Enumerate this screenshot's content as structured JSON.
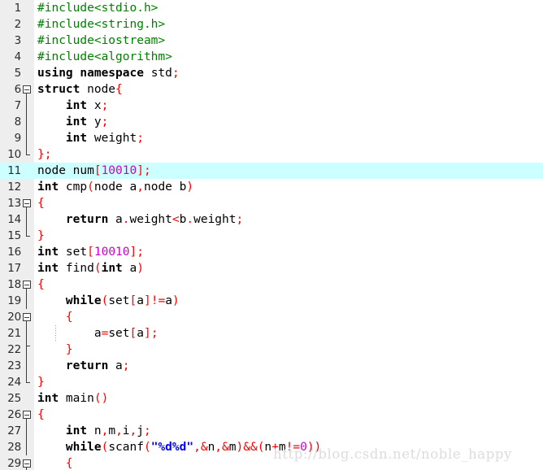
{
  "editor": {
    "language": "C++",
    "first_visible_line": 1,
    "last_visible_line": 29,
    "highlighted_line": 11,
    "gutter_background": "#eeeeee",
    "editor_background": "#ffffff",
    "current_line_highlight": "#ccffff",
    "colors": {
      "keyword": "#000000",
      "preprocessor": "#008000",
      "punctuation": "#ff0000",
      "number": "#cc00cc",
      "string": "#0000ff",
      "plain": "#000000",
      "line_number": "#2b2b2b",
      "fold_marker": "#3c3c3c",
      "indent_guide": "#9a9a9a",
      "watermark": "#dcdcdc"
    }
  },
  "watermark": {
    "text": "http://blog.csdn.net/noble_happy"
  },
  "lines": [
    {
      "n": "1",
      "fold": "none",
      "indent_guides": [],
      "tokens": [
        {
          "t": "#include<stdio.h>",
          "c": "pp"
        }
      ]
    },
    {
      "n": "2",
      "fold": "none",
      "indent_guides": [],
      "tokens": [
        {
          "t": "#include<string.h>",
          "c": "pp"
        }
      ]
    },
    {
      "n": "3",
      "fold": "none",
      "indent_guides": [],
      "tokens": [
        {
          "t": "#include<iostream>",
          "c": "pp"
        }
      ]
    },
    {
      "n": "4",
      "fold": "none",
      "indent_guides": [],
      "tokens": [
        {
          "t": "#include<algorithm>",
          "c": "pp"
        }
      ]
    },
    {
      "n": "5",
      "fold": "none",
      "indent_guides": [],
      "tokens": [
        {
          "t": "using namespace",
          "c": "kw"
        },
        {
          "t": " ",
          "c": "pln"
        },
        {
          "t": "std",
          "c": "pln"
        },
        {
          "t": ";",
          "c": "punc"
        }
      ]
    },
    {
      "n": "6",
      "fold": "box",
      "indent_guides": [],
      "tokens": [
        {
          "t": "struct",
          "c": "kw"
        },
        {
          "t": " node",
          "c": "pln"
        },
        {
          "t": "{",
          "c": "punc"
        }
      ]
    },
    {
      "n": "7",
      "fold": "line",
      "indent_guides": [],
      "tokens": [
        {
          "t": "    ",
          "c": "pln"
        },
        {
          "t": "int",
          "c": "kw"
        },
        {
          "t": " x",
          "c": "pln"
        },
        {
          "t": ";",
          "c": "punc"
        }
      ]
    },
    {
      "n": "8",
      "fold": "line",
      "indent_guides": [],
      "tokens": [
        {
          "t": "    ",
          "c": "pln"
        },
        {
          "t": "int",
          "c": "kw"
        },
        {
          "t": " y",
          "c": "pln"
        },
        {
          "t": ";",
          "c": "punc"
        }
      ]
    },
    {
      "n": "9",
      "fold": "line",
      "indent_guides": [],
      "tokens": [
        {
          "t": "    ",
          "c": "pln"
        },
        {
          "t": "int",
          "c": "kw"
        },
        {
          "t": " weight",
          "c": "pln"
        },
        {
          "t": ";",
          "c": "punc"
        }
      ]
    },
    {
      "n": "10",
      "fold": "end",
      "indent_guides": [],
      "tokens": [
        {
          "t": "};",
          "c": "punc"
        }
      ]
    },
    {
      "n": "11",
      "fold": "none",
      "highlight": true,
      "indent_guides": [],
      "tokens": [
        {
          "t": "node num",
          "c": "pln"
        },
        {
          "t": "[",
          "c": "punc"
        },
        {
          "t": "10010",
          "c": "num"
        },
        {
          "t": "];",
          "c": "punc"
        }
      ]
    },
    {
      "n": "12",
      "fold": "none",
      "indent_guides": [],
      "tokens": [
        {
          "t": "int",
          "c": "kw"
        },
        {
          "t": " cmp",
          "c": "pln"
        },
        {
          "t": "(",
          "c": "punc"
        },
        {
          "t": "node a",
          "c": "pln"
        },
        {
          "t": ",",
          "c": "punc"
        },
        {
          "t": "node b",
          "c": "pln"
        },
        {
          "t": ")",
          "c": "punc"
        }
      ]
    },
    {
      "n": "13",
      "fold": "box",
      "indent_guides": [],
      "tokens": [
        {
          "t": "{",
          "c": "punc"
        }
      ]
    },
    {
      "n": "14",
      "fold": "line",
      "indent_guides": [],
      "tokens": [
        {
          "t": "    ",
          "c": "pln"
        },
        {
          "t": "return",
          "c": "kw"
        },
        {
          "t": " a",
          "c": "pln"
        },
        {
          "t": ".",
          "c": "punc"
        },
        {
          "t": "weight",
          "c": "pln"
        },
        {
          "t": "<",
          "c": "punc"
        },
        {
          "t": "b",
          "c": "pln"
        },
        {
          "t": ".",
          "c": "punc"
        },
        {
          "t": "weight",
          "c": "pln"
        },
        {
          "t": ";",
          "c": "punc"
        }
      ]
    },
    {
      "n": "15",
      "fold": "end",
      "indent_guides": [],
      "tokens": [
        {
          "t": "}",
          "c": "punc"
        }
      ]
    },
    {
      "n": "16",
      "fold": "none",
      "indent_guides": [],
      "tokens": [
        {
          "t": "int",
          "c": "kw"
        },
        {
          "t": " set",
          "c": "pln"
        },
        {
          "t": "[",
          "c": "punc"
        },
        {
          "t": "10010",
          "c": "num"
        },
        {
          "t": "];",
          "c": "punc"
        }
      ]
    },
    {
      "n": "17",
      "fold": "none",
      "indent_guides": [],
      "tokens": [
        {
          "t": "int",
          "c": "kw"
        },
        {
          "t": " find",
          "c": "pln"
        },
        {
          "t": "(",
          "c": "punc"
        },
        {
          "t": "int",
          "c": "kw"
        },
        {
          "t": " a",
          "c": "pln"
        },
        {
          "t": ")",
          "c": "punc"
        }
      ]
    },
    {
      "n": "18",
      "fold": "box",
      "indent_guides": [],
      "tokens": [
        {
          "t": "{",
          "c": "punc"
        }
      ]
    },
    {
      "n": "19",
      "fold": "line",
      "indent_guides": [],
      "tokens": [
        {
          "t": "    ",
          "c": "pln"
        },
        {
          "t": "while",
          "c": "kw"
        },
        {
          "t": "(",
          "c": "punc"
        },
        {
          "t": "set",
          "c": "pln"
        },
        {
          "t": "[",
          "c": "punc"
        },
        {
          "t": "a",
          "c": "pln"
        },
        {
          "t": "]!=",
          "c": "punc"
        },
        {
          "t": "a",
          "c": "pln"
        },
        {
          "t": ")",
          "c": "punc"
        }
      ]
    },
    {
      "n": "20",
      "fold": "box-in-line",
      "indent_guides": [],
      "tokens": [
        {
          "t": "    ",
          "c": "pln"
        },
        {
          "t": "{",
          "c": "punc"
        }
      ]
    },
    {
      "n": "21",
      "fold": "line",
      "indent_guides": [
        68
      ],
      "tokens": [
        {
          "t": "        ",
          "c": "pln"
        },
        {
          "t": "a",
          "c": "pln"
        },
        {
          "t": "=",
          "c": "punc"
        },
        {
          "t": "set",
          "c": "pln"
        },
        {
          "t": "[",
          "c": "punc"
        },
        {
          "t": "a",
          "c": "pln"
        },
        {
          "t": "];",
          "c": "punc"
        }
      ]
    },
    {
      "n": "22",
      "fold": "tick",
      "indent_guides": [],
      "tokens": [
        {
          "t": "    ",
          "c": "pln"
        },
        {
          "t": "}",
          "c": "punc"
        }
      ]
    },
    {
      "n": "23",
      "fold": "line",
      "indent_guides": [],
      "tokens": [
        {
          "t": "    ",
          "c": "pln"
        },
        {
          "t": "return",
          "c": "kw"
        },
        {
          "t": " a",
          "c": "pln"
        },
        {
          "t": ";",
          "c": "punc"
        }
      ]
    },
    {
      "n": "24",
      "fold": "end",
      "indent_guides": [],
      "tokens": [
        {
          "t": "}",
          "c": "punc"
        }
      ]
    },
    {
      "n": "25",
      "fold": "none",
      "indent_guides": [],
      "tokens": [
        {
          "t": "int",
          "c": "kw"
        },
        {
          "t": " main",
          "c": "pln"
        },
        {
          "t": "()",
          "c": "punc"
        }
      ]
    },
    {
      "n": "26",
      "fold": "box",
      "indent_guides": [],
      "tokens": [
        {
          "t": "{",
          "c": "punc"
        }
      ]
    },
    {
      "n": "27",
      "fold": "line",
      "indent_guides": [],
      "tokens": [
        {
          "t": "    ",
          "c": "pln"
        },
        {
          "t": "int",
          "c": "kw"
        },
        {
          "t": " n",
          "c": "pln"
        },
        {
          "t": ",",
          "c": "punc"
        },
        {
          "t": "m",
          "c": "pln"
        },
        {
          "t": ",",
          "c": "punc"
        },
        {
          "t": "i",
          "c": "pln"
        },
        {
          "t": ",",
          "c": "punc"
        },
        {
          "t": "j",
          "c": "pln"
        },
        {
          "t": ";",
          "c": "punc"
        }
      ]
    },
    {
      "n": "28",
      "fold": "line",
      "indent_guides": [],
      "tokens": [
        {
          "t": "    ",
          "c": "pln"
        },
        {
          "t": "while",
          "c": "kw"
        },
        {
          "t": "(",
          "c": "punc"
        },
        {
          "t": "scanf",
          "c": "pln"
        },
        {
          "t": "(",
          "c": "punc"
        },
        {
          "t": "\"%d%d\"",
          "c": "str"
        },
        {
          "t": ",&",
          "c": "punc"
        },
        {
          "t": "n",
          "c": "pln"
        },
        {
          "t": ",&",
          "c": "punc"
        },
        {
          "t": "m",
          "c": "pln"
        },
        {
          "t": ")&&(",
          "c": "punc"
        },
        {
          "t": "n",
          "c": "pln"
        },
        {
          "t": "+",
          "c": "punc"
        },
        {
          "t": "m",
          "c": "pln"
        },
        {
          "t": "!=",
          "c": "punc"
        },
        {
          "t": "0",
          "c": "num"
        },
        {
          "t": "))",
          "c": "punc"
        }
      ]
    },
    {
      "n": "29",
      "fold": "box-in-line",
      "indent_guides": [],
      "tokens": [
        {
          "t": "    ",
          "c": "pln"
        },
        {
          "t": "{",
          "c": "punc"
        }
      ]
    }
  ]
}
